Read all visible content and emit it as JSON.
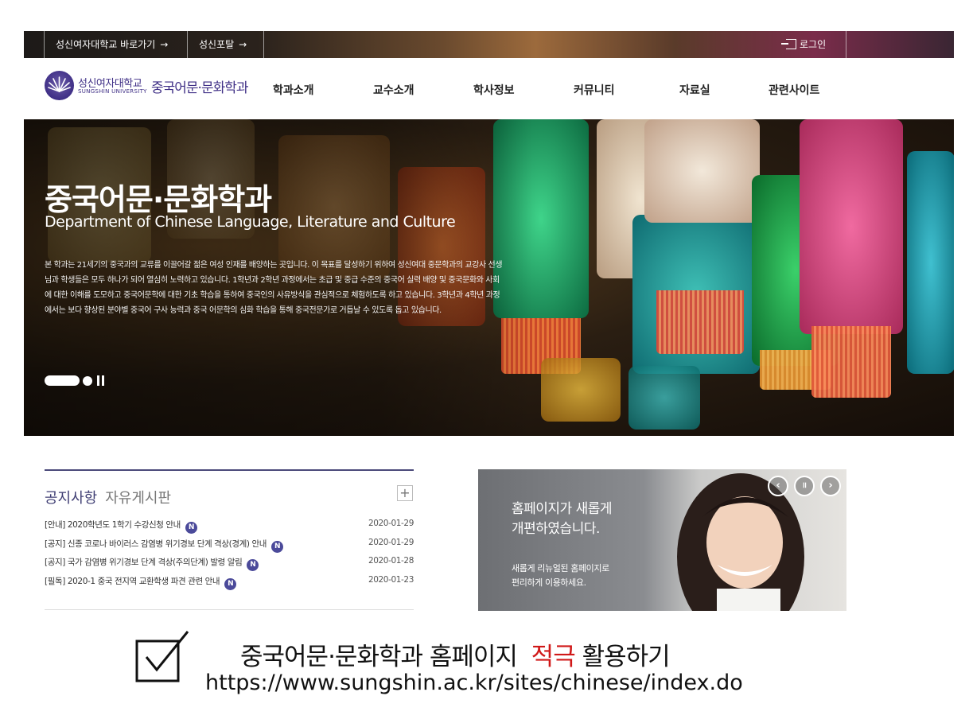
{
  "topbar": {
    "link1": "성신여자대학교 바로가기",
    "link2": "성신포탈",
    "arrow": "→",
    "login": "로그인"
  },
  "logo": {
    "university": "성신여자대학교",
    "university_en": "SUNGSHIN UNIVERSITY",
    "department": "중국어문·문화학과"
  },
  "nav": {
    "items": [
      "학과소개",
      "교수소개",
      "학사정보",
      "커뮤니티",
      "자료실",
      "관련사이트"
    ]
  },
  "hero": {
    "title": "중국어문·문화학과",
    "subtitle": "Department of Chinese Language, Literature and Culture",
    "description": "본 학과는 21세기의 중국과의 교류를 이끌어갈 젊은 여성 인재를 배양하는 곳입니다. 이 목표를 달성하기 위하여 성신여대 중문학과의 교강사 선생님과 학생들은 모두 하나가 되어 열심히 노력하고 있습니다. 1학년과 2학년 과정에서는 초급 및 중급 수준의 중국어 실력 배양 및 중국문화와 사회에 대한 이해를 도모하고 중국어문학에 대한 기초 학습을 통하여 중국인의 사유방식을 관심적으로 체험하도록 하고 있습니다. 3학년과 4학년 과정에서는 보다 향상된 분야별 중국어 구사 능력과 중국 어문학의 심화 학습을 통해 중국전문가로 거듭날 수 있도록 돕고 있습니다."
  },
  "board": {
    "tab_active": "공지사항",
    "tab_inactive": "자유게시판",
    "more": "+",
    "new_badge": "N",
    "posts": [
      {
        "title": "[안내] 2020학년도 1학기 수강신청 안내",
        "date": "2020-01-29"
      },
      {
        "title": "[공지] 신종 코로나 바이러스 감염병 위기경보 단계 격상(경계) 안내",
        "date": "2020-01-29"
      },
      {
        "title": "[공지] 국가 감염병 위기경보 단계 격상(주의단계) 발령 알림",
        "date": "2020-01-28"
      },
      {
        "title": "[필독] 2020-1 중국 전지역 교환학생 파견 관련 안내",
        "date": "2020-01-23"
      }
    ]
  },
  "promo": {
    "headline_1": "홈페이지가 새롭게",
    "headline_2": "개편하였습니다.",
    "sub_1": "새롭게 리뉴얼된 홈페이지로",
    "sub_2": "편리하게 이용하세요.",
    "prev": "‹",
    "pause": "॥",
    "next": "›"
  },
  "callout": {
    "slogan_before": "중국어문·문화학과 홈페이지",
    "slogan_accent": "적극",
    "slogan_after": "활용하기",
    "url": "https://www.sungshin.ac.kr/sites/chinese/index.do"
  },
  "colors": {
    "brand_purple": "#3f2f86",
    "accent_red": "#d01818",
    "badge": "#4b4a9a"
  }
}
